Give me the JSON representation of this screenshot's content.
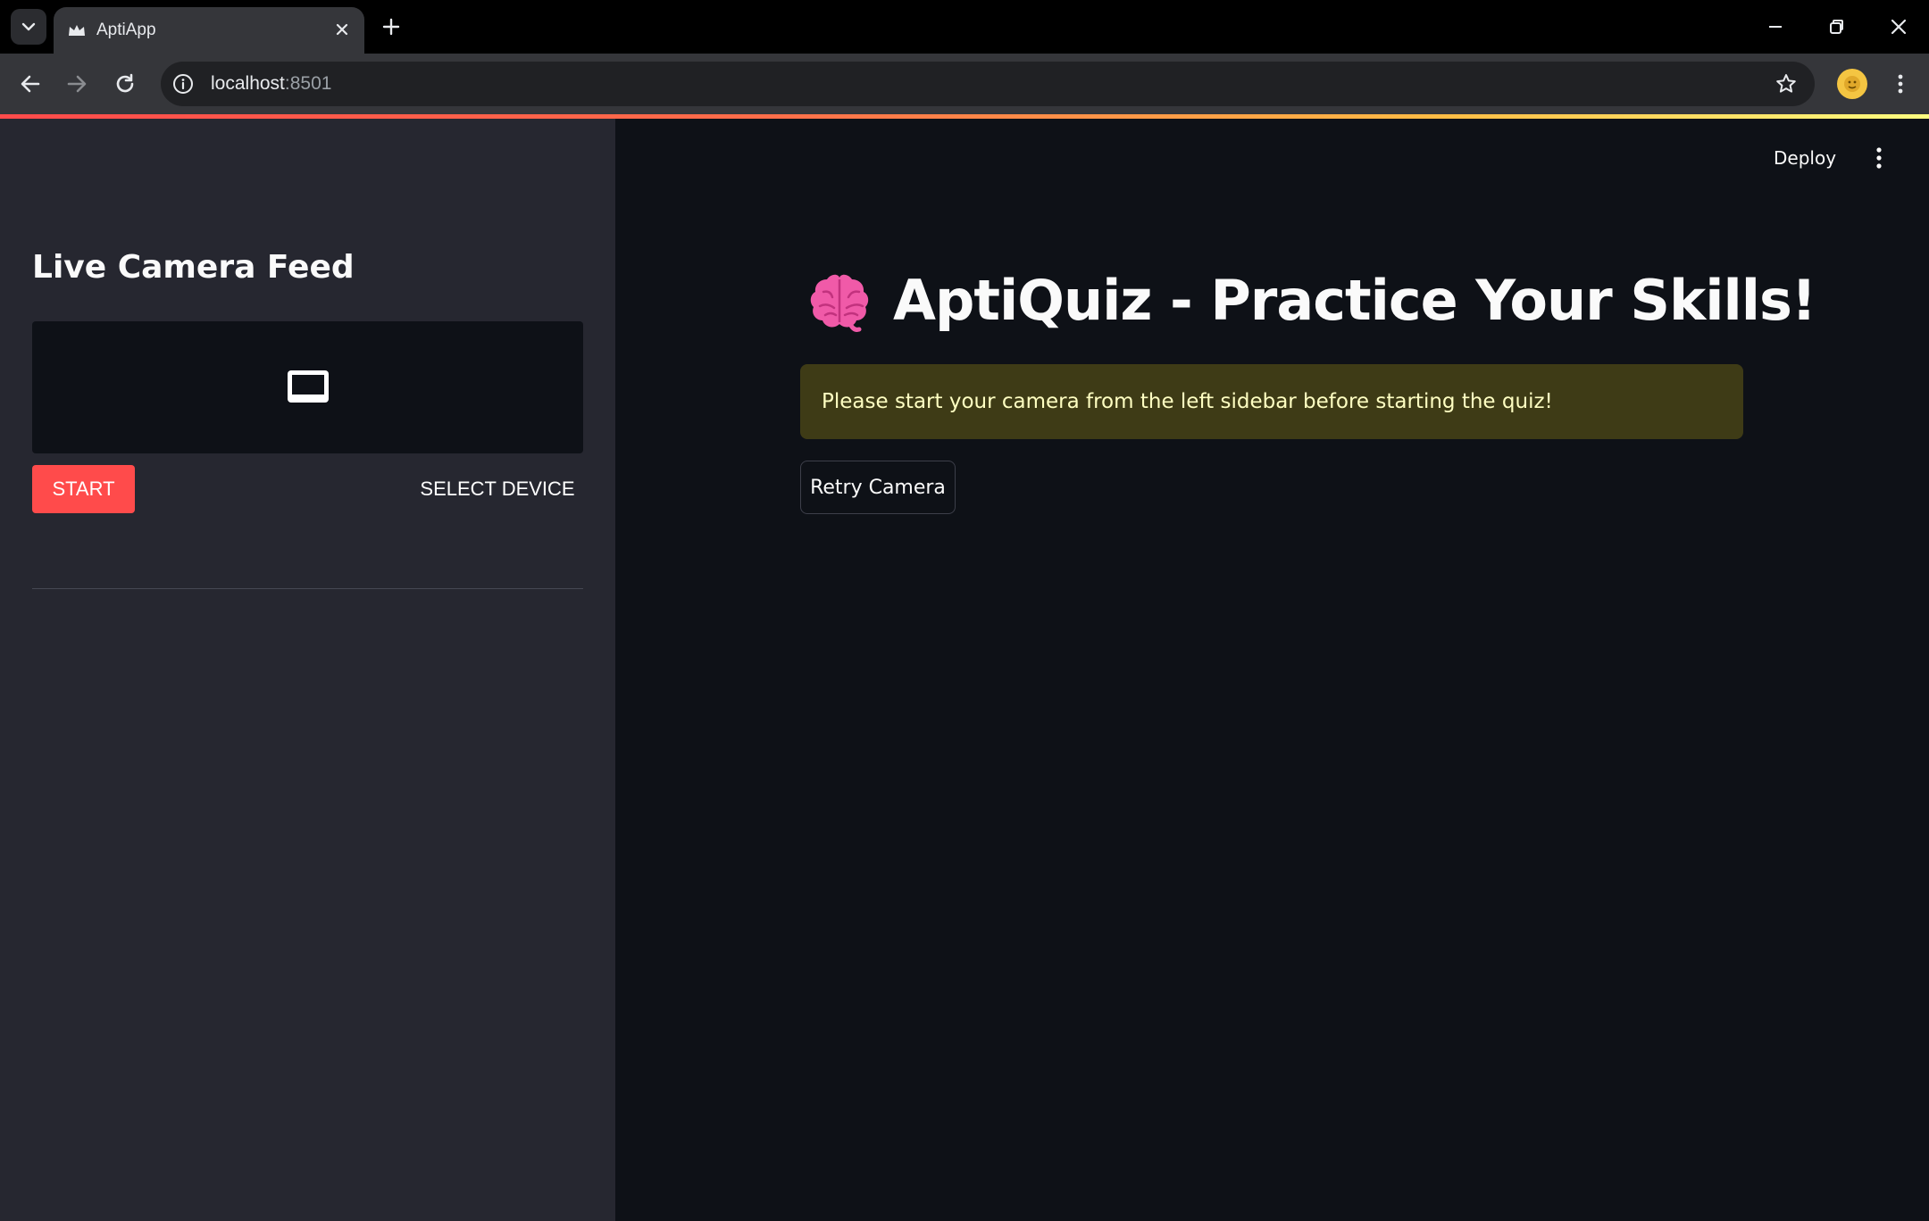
{
  "browser": {
    "tab_title": "AptiApp",
    "url_host": "localhost",
    "url_port": ":8501"
  },
  "sidebar": {
    "title": "Live Camera Feed",
    "start_label": "START",
    "select_device_label": "SELECT DEVICE"
  },
  "header": {
    "deploy_label": "Deploy"
  },
  "main": {
    "title": "AptiQuiz - Practice Your Skills!",
    "warning": "Please start your camera from the left sidebar before starting the quiz!",
    "retry_label": "Retry Camera"
  },
  "colors": {
    "accent": "#ff4b4b",
    "sidebar_bg": "#262730",
    "main_bg": "#0e1117",
    "warning_bg": "#3e3b16",
    "warning_text": "#ffffc2"
  },
  "icons": [
    "tab-search-icon",
    "crown-favicon-icon",
    "close-icon",
    "plus-icon",
    "minimize-icon",
    "restore-icon",
    "window-close-icon",
    "back-icon",
    "forward-icon",
    "reload-icon",
    "info-icon",
    "star-icon",
    "avatar",
    "kebab-menu-icon",
    "monitor-icon",
    "brain-icon"
  ]
}
